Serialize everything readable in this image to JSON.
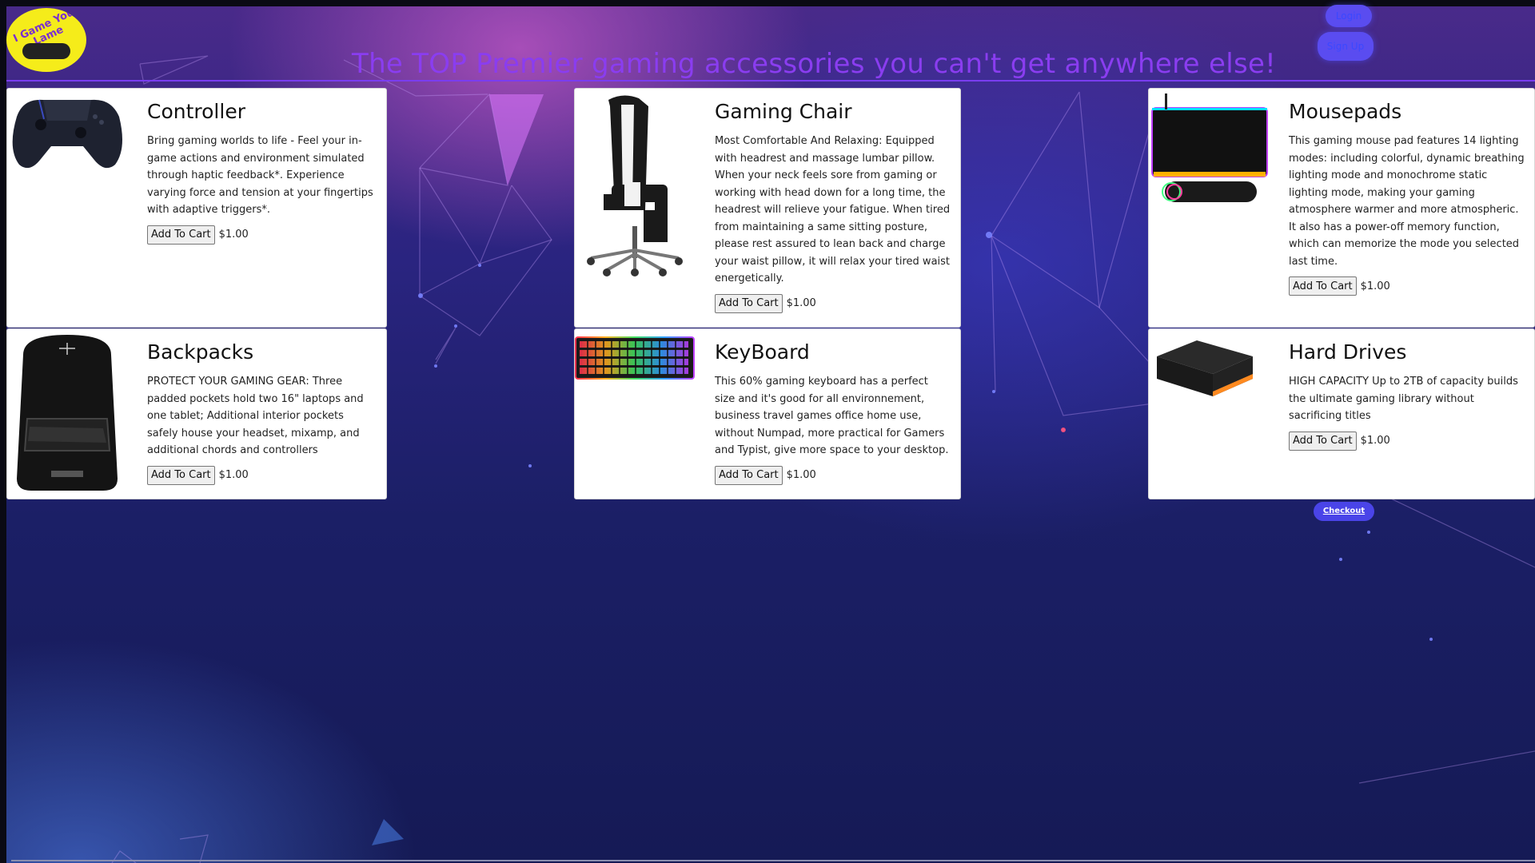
{
  "brand": {
    "logo_text": "I Game You Lame"
  },
  "nav": {
    "login_label": "Login",
    "signup_label": "Sign Up"
  },
  "headline": "The TOP Premier gaming accessories you can't get anywhere else!",
  "products": [
    {
      "title": "Controller",
      "description": "Bring gaming worlds to life - Feel your in-game actions and environment simulated through haptic feedback*. Experience varying force and tension at your fingertips with adaptive triggers*.",
      "button_label": "Add To Cart",
      "price": "$1.00"
    },
    {
      "title": "Gaming Chair",
      "description": "Most Comfortable And Relaxing: Equipped with headrest and massage lumbar pillow. When your neck feels sore from gaming or working with head down for a long time, the headrest will relieve your fatigue. When tired from maintaining a same sitting posture, please rest assured to lean back and charge your waist pillow, it will relax your tired waist energetically.",
      "button_label": "Add To Cart",
      "price": "$1.00"
    },
    {
      "title": "Mousepads",
      "description": "This gaming mouse pad features 14 lighting modes: including colorful, dynamic breathing lighting mode and monochrome static lighting mode, making your gaming atmosphere warmer and more atmospheric. It also has a power-off memory function, which can memorize the mode you selected last time.",
      "button_label": "Add To Cart",
      "price": "$1.00"
    },
    {
      "title": "Backpacks",
      "description": "PROTECT YOUR GAMING GEAR: Three padded pockets hold two 16\" laptops and one tablet; Additional interior pockets safely house your headset, mixamp, and additional chords and controllers",
      "button_label": "Add To Cart",
      "price": "$1.00"
    },
    {
      "title": "KeyBoard",
      "description": "This 60% gaming keyboard has a perfect size and it's good for all environnement, business travel games office home use, without Numpad, more practical for Gamers and Typist, give more space to your desktop.",
      "button_label": "Add To Cart",
      "price": "$1.00"
    },
    {
      "title": "Hard Drives",
      "description": "HIGH CAPACITY Up to 2TB of capacity builds the ultimate gaming library without sacrificing titles",
      "button_label": "Add To Cart",
      "price": "$1.00"
    }
  ],
  "checkout_label": "Checkout",
  "colors": {
    "headline": "#8a3df0",
    "nav_button": "#5a4cf0",
    "checkout_button": "#4a44e8",
    "logo_bg": "#f5ec1a"
  }
}
